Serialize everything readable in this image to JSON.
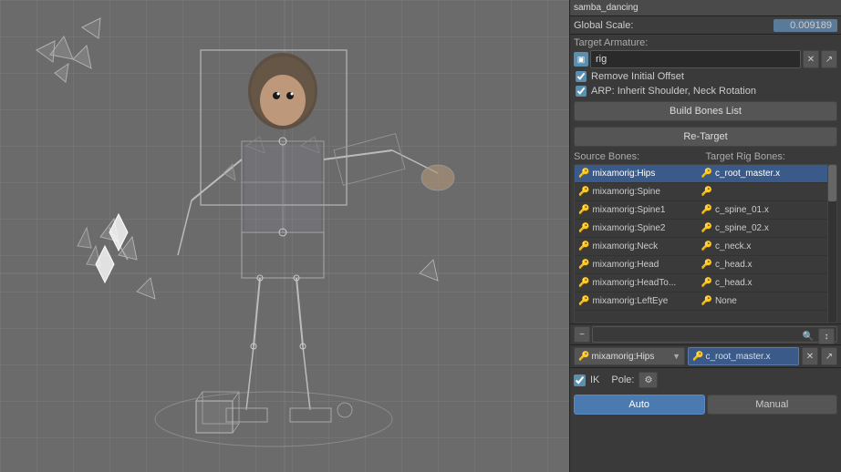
{
  "viewport": {
    "background": "#6b6b6b"
  },
  "panel": {
    "top_strip": "samba_dancing",
    "global_scale_label": "Global Scale:",
    "global_scale_value": "0.009189",
    "target_armature_label": "Target Armature:",
    "rig_value": "rig",
    "remove_offset_label": "Remove Initial Offset",
    "arp_inherit_label": "ARP: Inherit Shoulder, Neck Rotation",
    "build_bones_btn": "Build Bones List",
    "retarget_btn": "Re-Target",
    "source_bones_label": "Source Bones:",
    "target_rig_label": "Target Rig Bones:",
    "bones": [
      {
        "source": "mixamorig:Hips",
        "target": "c_root_master.x",
        "selected": true
      },
      {
        "source": "mixamorig:Spine",
        "target": "",
        "selected": false
      },
      {
        "source": "mixamorig:Spine1",
        "target": "c_spine_01.x",
        "selected": false
      },
      {
        "source": "mixamorig:Spine2",
        "target": "c_spine_02.x",
        "selected": false
      },
      {
        "source": "mixamorig:Neck",
        "target": "c_neck.x",
        "selected": false
      },
      {
        "source": "mixamorig:Head",
        "target": "c_head.x",
        "selected": false
      },
      {
        "source": "mixamorig:HeadTo...",
        "target": "c_head.x",
        "selected": false
      },
      {
        "source": "mixamorig:LeftEye",
        "target": "None",
        "selected": false
      }
    ],
    "mapping_source": "mixamorig:Hips",
    "mapping_target": "c_root_master.x",
    "ik_label": "IK",
    "pole_label": "Pole:",
    "auto_label": "Auto",
    "manual_label": "Manual"
  }
}
